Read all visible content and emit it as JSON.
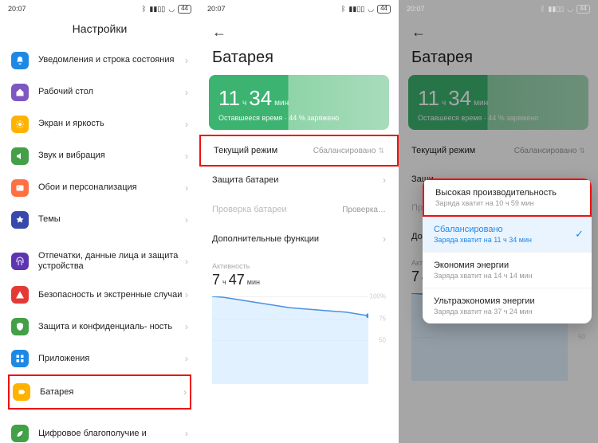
{
  "status": {
    "time": "20:07",
    "battery": "44"
  },
  "panel1": {
    "title": "Настройки",
    "items": [
      {
        "label": "Уведомления и строка состояния",
        "color": "#1e88e5",
        "icon": "bell"
      },
      {
        "label": "Рабочий стол",
        "color": "#7e57c2",
        "icon": "home"
      },
      {
        "label": "Экран и яркость",
        "color": "#ffb300",
        "icon": "sun"
      },
      {
        "label": "Звук и вибрация",
        "color": "#43a047",
        "icon": "sound"
      },
      {
        "label": "Обои и персонализация",
        "color": "#ff7043",
        "icon": "image"
      },
      {
        "label": "Темы",
        "color": "#3949ab",
        "icon": "theme"
      }
    ],
    "items2": [
      {
        "label": "Отпечатки, данные лица и защита устройства",
        "color": "#5e35b1",
        "icon": "finger"
      },
      {
        "label": "Безопасность и экстренные случаи",
        "color": "#e53935",
        "icon": "alert"
      },
      {
        "label": "Защита и конфиденциаль-\nность",
        "color": "#43a047",
        "icon": "shield"
      },
      {
        "label": "Приложения",
        "color": "#1e88e5",
        "icon": "apps"
      },
      {
        "label": "Батарея",
        "color": "#ffb300",
        "icon": "battery",
        "hl": true
      }
    ],
    "items3": [
      {
        "label": "Цифровое благополучие и",
        "color": "#43a047",
        "icon": "leaf"
      }
    ]
  },
  "panel2": {
    "title": "Батарея",
    "card": {
      "h": "11",
      "hu": "ч",
      "m": "34",
      "mu": "мин",
      "sub": "Оставшееся время · 44 % заряжено"
    },
    "rows": [
      {
        "label": "Текущий режим",
        "value": "Сбалансировано",
        "kind": "select",
        "hl": true
      },
      {
        "label": "Защита батареи",
        "kind": "chev"
      },
      {
        "label": "Проверка батареи",
        "value": "Проверка…",
        "kind": "text",
        "disabled": true
      },
      {
        "label": "Дополнительные функции",
        "kind": "chev"
      }
    ],
    "activity": {
      "label": "Активность",
      "h": "7",
      "hu": "ч",
      "m": "47",
      "mu": "мин"
    }
  },
  "panel3": {
    "popup": [
      {
        "title": "Высокая производительность",
        "sub": "Заряда хватит на 10 ч 59 мин",
        "hl": true
      },
      {
        "title": "Сбалансировано",
        "sub": "Заряда хватит на 11 ч 34 мин",
        "selected": true
      },
      {
        "title": "Экономия энергии",
        "sub": "Заряда хватит на 14 ч 14 мин"
      },
      {
        "title": "Ультраэкономия энергии",
        "sub": "Заряда хватит на 37 ч 24 мин"
      }
    ],
    "visible": {
      "mode_label": "Текущий режим",
      "mode_value": "Сбалансировано",
      "r2": "Защи",
      "r3": "Пров",
      "r4": "Допо",
      "act": "Актив"
    }
  },
  "chart_data": {
    "type": "line",
    "title": "",
    "xlabel": "",
    "ylabel": "%",
    "ylim": [
      0,
      100
    ],
    "yticks": [
      100,
      75,
      50
    ],
    "x": [
      0,
      1,
      2,
      3,
      4,
      5,
      6,
      7,
      8,
      9,
      10,
      11,
      12,
      13,
      14
    ],
    "series": [
      {
        "name": "battery",
        "values": [
          100,
          99,
          97,
          95,
          93,
          91,
          89,
          87,
          86,
          85,
          84,
          83,
          82,
          80,
          78
        ]
      }
    ]
  }
}
